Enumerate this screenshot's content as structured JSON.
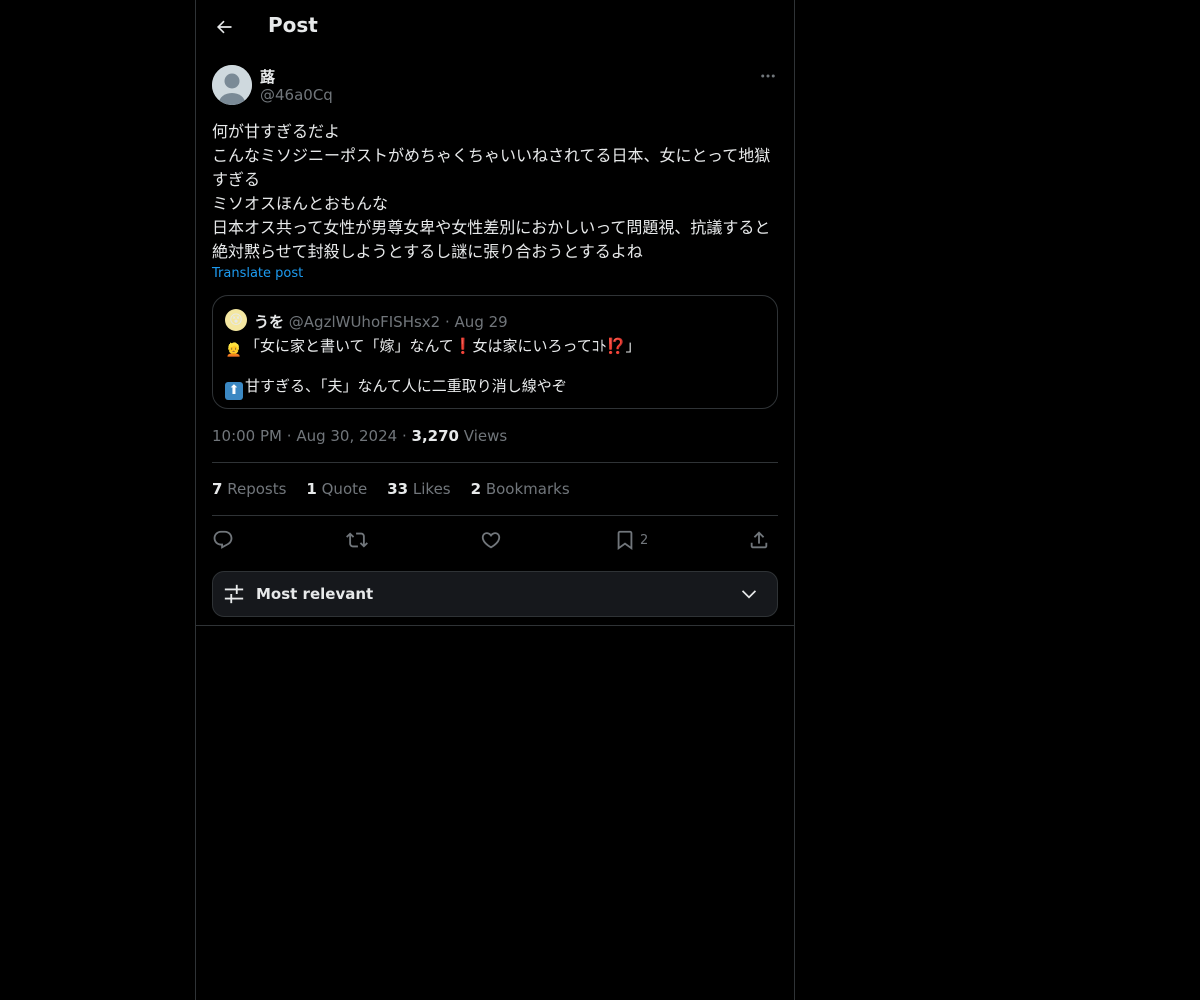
{
  "header": {
    "title": "Post"
  },
  "post": {
    "author": {
      "display_name": "蕗",
      "handle": "@46a0Cq"
    },
    "text": "何が甘すぎるだよ\nこんなミソジニーポストがめちゃくちゃいいねされてる日本、女にとって地獄すぎる\nミソオスほんとおもんな\n日本オス共って女性が男尊女卑や女性差別におかしいって問題視、抗議すると絶対黙らせて封殺しようとするし謎に張り合おうとするよね",
    "translate_label": "Translate post",
    "quote": {
      "display_name": "うを",
      "handle": "@AgzlWUhoFISHsx2",
      "separator": "·",
      "date": "Aug 29",
      "line1_emoji": "👱",
      "line1_a": "「女に家と書いて「嫁」なんて",
      "line1_emoji2": "❗",
      "line1_b": "女は家にいろってｺﾄ",
      "line1_emoji3": "⁉️",
      "line1_c": "」",
      "line2_emoji": "⬆️",
      "line2_text": "甘すぎる、「夫」なんて人に二重取り消し線やぞ"
    },
    "meta": {
      "time": "10:00 PM",
      "separator": "·",
      "date": "Aug 30, 2024",
      "views_count": "3,270",
      "views_label": "Views"
    },
    "stats": [
      {
        "count": "7",
        "label": "Reposts"
      },
      {
        "count": "1",
        "label": "Quote"
      },
      {
        "count": "33",
        "label": "Likes"
      },
      {
        "count": "2",
        "label": "Bookmarks"
      }
    ],
    "actions": {
      "reply_icon": "reply-icon",
      "repost_icon": "repost-icon",
      "like_icon": "heart-icon",
      "bookmark_icon": "bookmark-icon",
      "bookmark_count": "2",
      "share_icon": "share-icon"
    }
  },
  "replies_sort": {
    "label": "Most relevant"
  },
  "colors": {
    "background": "#000000",
    "border": "#2f3336",
    "text_primary": "#e7e9ea",
    "text_secondary": "#71767b",
    "link": "#1d9bf0"
  }
}
